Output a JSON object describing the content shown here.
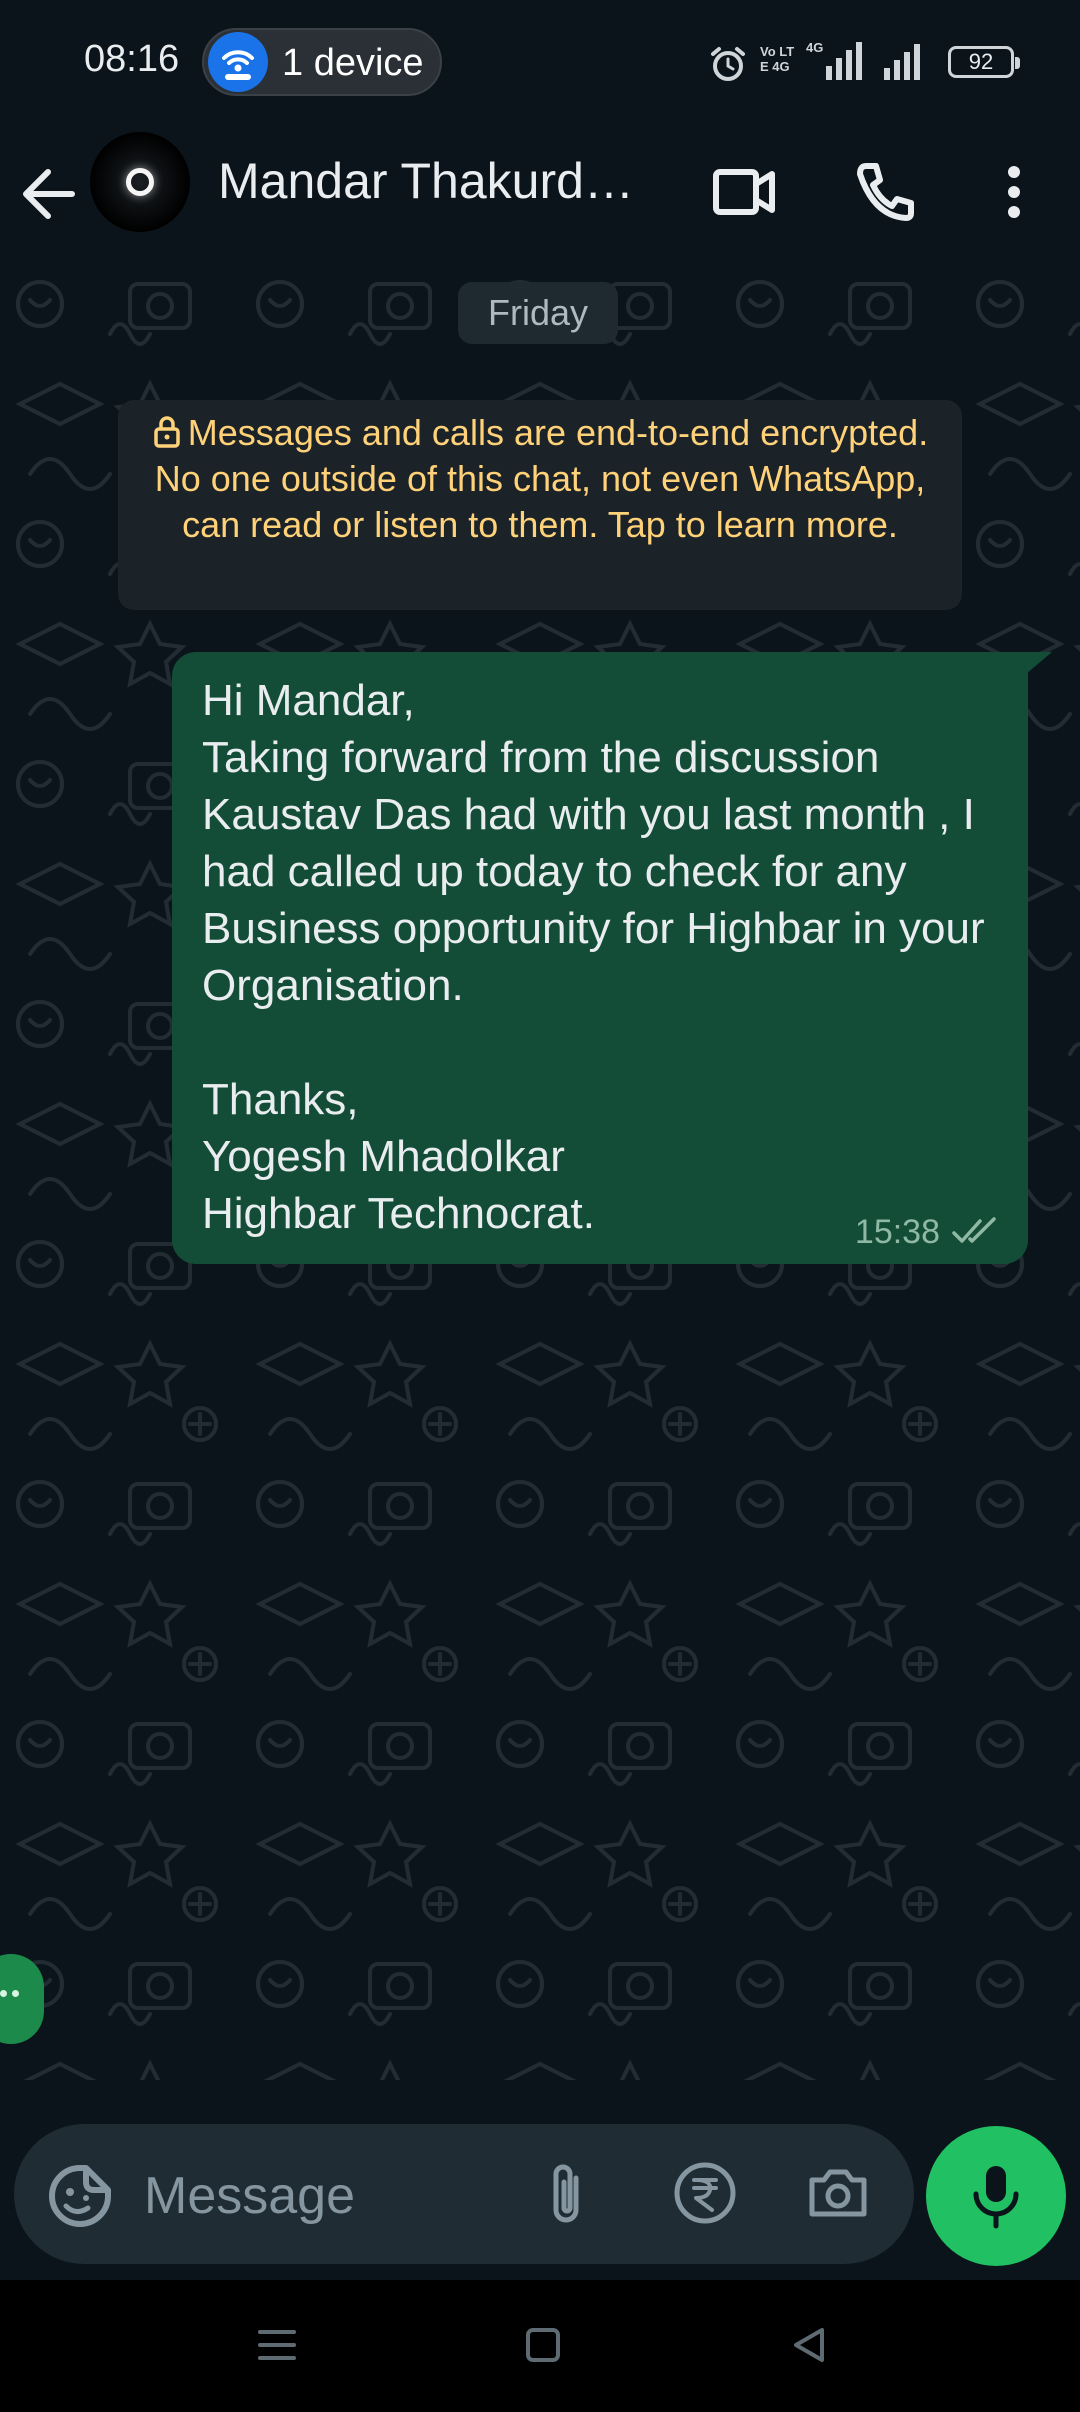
{
  "status_bar": {
    "time": "08:16",
    "hotspot_label": "1 device",
    "network_label": "Vo LTE 4G",
    "battery": "92"
  },
  "header": {
    "contact_name": "Mandar Thakurde…",
    "icons": [
      "back-arrow-icon",
      "video-call-icon",
      "voice-call-icon",
      "more-options-icon"
    ]
  },
  "chat": {
    "date_chip": "Friday",
    "encryption_notice": "Messages and calls are end-to-end encrypted. No one outside of this chat, not even WhatsApp, can read or listen to them. Tap to learn more.",
    "messages": [
      {
        "direction": "outgoing",
        "text": "Hi Mandar,\nTaking forward from the discussion Kaustav Das had with you last month , I had called up today to check for any Business opportunity for Highbar in your Organisation.\n\nThanks,\nYogesh Mhadolkar\nHighbar Technocrat.",
        "time": "15:38",
        "status": "delivered"
      }
    ]
  },
  "composer": {
    "placeholder": "Message",
    "icons": [
      "sticker-emoji-icon",
      "attach-icon",
      "rupee-payment-icon",
      "camera-icon",
      "microphone-icon"
    ]
  },
  "colors": {
    "background": "#0b141a",
    "outgoing_bubble": "#144d37",
    "accent_green": "#21c063",
    "notice_text": "#ffd279"
  }
}
